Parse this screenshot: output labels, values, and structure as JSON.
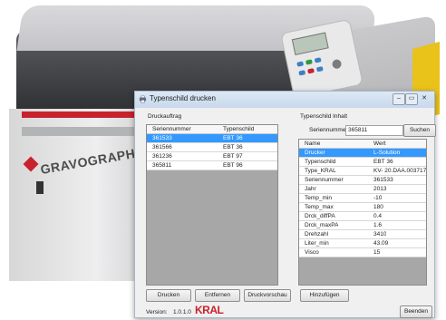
{
  "machine": {
    "brand": "GRAVOGRAPH"
  },
  "dialog": {
    "title": "Typenschild drucken",
    "title_buttons": [
      "–",
      "▭",
      "✕"
    ],
    "left_group_label": "Druckauftrag",
    "left_columns": [
      "Seriennummer",
      "Typenschild"
    ],
    "left_rows": [
      [
        "361533",
        "EBT 36"
      ],
      [
        "361566",
        "EBT 36"
      ],
      [
        "361236",
        "EBT 97"
      ],
      [
        "365811",
        "EBT 96"
      ]
    ],
    "right_group_label": "Typenschild Inhalt",
    "serial_label": "Seriennummer",
    "serial_value": "365811",
    "search_button": "Suchen",
    "right_columns": [
      "Name",
      "Wert"
    ],
    "right_rows": [
      [
        "Drucker",
        "L-Solution"
      ],
      [
        "Typenschild",
        "EBT 36"
      ],
      [
        "Type_KRAL",
        "KV- 20.DAA.003717"
      ],
      [
        "Seriennummer",
        "361533"
      ],
      [
        "Jahr",
        "2013"
      ],
      [
        "Temp_min",
        "-10"
      ],
      [
        "Temp_max",
        "180"
      ],
      [
        "Drck_diffPA",
        "0.4"
      ],
      [
        "Drck_maxPA",
        "1.6"
      ],
      [
        "Drehzahl",
        "3410"
      ],
      [
        "Liter_min",
        "43.09"
      ],
      [
        "Visco",
        "15"
      ]
    ],
    "buttons": {
      "print": "Drucken",
      "remove": "Entfernen",
      "preview": "Druckvorschau",
      "add": "Hinzufügen",
      "exit": "Beenden"
    },
    "version_label": "Version:",
    "version_value": "1.0.1.0",
    "logo_text": "KRAL"
  }
}
